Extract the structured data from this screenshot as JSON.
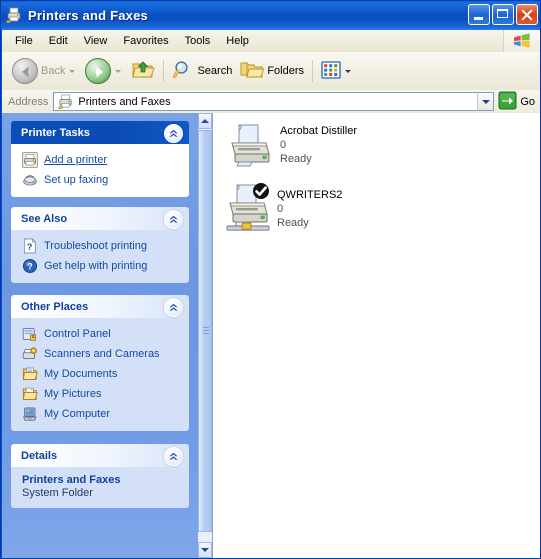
{
  "window": {
    "title": "Printers and Faxes",
    "icon": "printers-and-faxes-icon",
    "buttons": {
      "minimize": "Minimize",
      "maximize": "Maximize",
      "close": "Close"
    }
  },
  "menubar": {
    "items": [
      {
        "label": "File",
        "name": "menu-file"
      },
      {
        "label": "Edit",
        "name": "menu-edit"
      },
      {
        "label": "View",
        "name": "menu-view"
      },
      {
        "label": "Favorites",
        "name": "menu-favorites"
      },
      {
        "label": "Tools",
        "name": "menu-tools"
      },
      {
        "label": "Help",
        "name": "menu-help"
      }
    ],
    "brand_icon": "windows-flag-icon"
  },
  "toolbar": {
    "back_label": "Back",
    "forward_label": "",
    "up_label": "",
    "search_label": "Search",
    "folders_label": "Folders",
    "views_label": ""
  },
  "address": {
    "label": "Address",
    "value": "Printers and Faxes",
    "go_label": "Go"
  },
  "sidebar": {
    "panels": [
      {
        "title": "Printer Tasks",
        "style": "dark",
        "items": [
          {
            "label": "Add a printer",
            "icon": "add-printer-icon",
            "underline": true
          },
          {
            "label": "Set up faxing",
            "icon": "fax-icon",
            "underline": false
          }
        ]
      },
      {
        "title": "See Also",
        "style": "light",
        "items": [
          {
            "label": "Troubleshoot printing",
            "icon": "help-question-icon",
            "underline": false
          },
          {
            "label": "Get help with printing",
            "icon": "help-circle-icon",
            "underline": false
          }
        ]
      },
      {
        "title": "Other Places",
        "style": "light",
        "items": [
          {
            "label": "Control Panel",
            "icon": "control-panel-icon",
            "underline": false
          },
          {
            "label": "Scanners and Cameras",
            "icon": "scanners-cameras-icon",
            "underline": false
          },
          {
            "label": "My Documents",
            "icon": "my-documents-icon",
            "underline": false
          },
          {
            "label": "My Pictures",
            "icon": "my-pictures-icon",
            "underline": false
          },
          {
            "label": "My Computer",
            "icon": "my-computer-icon",
            "underline": false
          }
        ]
      }
    ],
    "details": {
      "title": "Details",
      "name": "Printers and Faxes",
      "type": "System Folder"
    }
  },
  "content": {
    "printers": [
      {
        "name": "Acrobat Distiller",
        "jobs": "0",
        "status": "Ready",
        "is_default": false,
        "is_shared": false
      },
      {
        "name": "QWRITERS2",
        "jobs": "0",
        "status": "Ready",
        "is_default": true,
        "is_shared": true
      }
    ]
  },
  "colors": {
    "titlebar_blue": "#0a52c8",
    "sidebar_blue": "#6f9ae5",
    "panel_header_dark": "#0c4cb8",
    "link_blue": "#134ba2",
    "close_red": "#d4431a"
  }
}
